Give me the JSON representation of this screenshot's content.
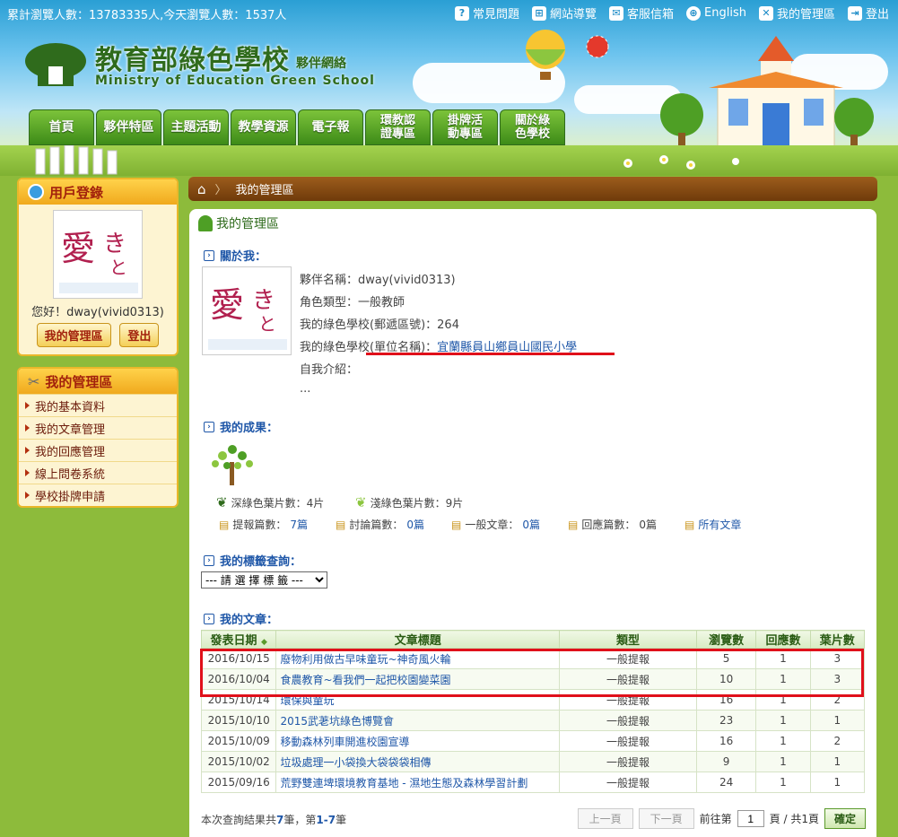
{
  "topbar": {
    "counter": "累計瀏覽人數：13783335人,今天瀏覽人數：1537人",
    "links": [
      "常見問題",
      "網站導覽",
      "客服信箱",
      "English",
      "我的管理區",
      "登出"
    ]
  },
  "logo": {
    "title": "教育部綠色學校",
    "subtitle": "夥伴網絡",
    "english": "Ministry of Education Green School"
  },
  "nav": [
    "首頁",
    "夥伴特區",
    "主題活動",
    "教學資源",
    "電子報",
    "環教認證專區",
    "掛牌活動專區",
    "關於綠色學校"
  ],
  "login": {
    "title": "用戶登錄",
    "greeting": "您好！dway(vivid0313)",
    "my_area": "我的管理區",
    "logout": "登出"
  },
  "manage": {
    "title": "我的管理區",
    "items": [
      "我的基本資料",
      "我的文章管理",
      "我的回應管理",
      "線上問卷系統",
      "學校掛牌申請"
    ]
  },
  "breadcrumb": "我的管理區",
  "main": {
    "title": "我的管理區",
    "about": {
      "heading": "關於我：",
      "partner": "夥伴名稱：dway(vivid0313)",
      "role": "角色類型：一般教師",
      "school_zip_label": "我的綠色學校(郵遞區號)：",
      "school_zip": "264",
      "school_name_label": "我的綠色學校(單位名稱)：",
      "school_name": "宜蘭縣員山鄉員山國民小學",
      "intro_label": "自我介紹：",
      "intro": "..."
    },
    "results": {
      "heading": "我的成果：",
      "dark_leaves": "深綠色葉片數：4片",
      "light_leaves": "淺綠色葉片數：9片",
      "proposal_label": "提報篇數：",
      "proposal": "7篇",
      "discuss_label": "討論篇數：",
      "discuss": "0篇",
      "general_label": "一般文章：",
      "general": "0篇",
      "reply_label": "回應篇數：",
      "reply": "0篇",
      "all": "所有文章"
    },
    "tags": {
      "heading": "我的標籤查詢：",
      "placeholder": "--- 請 選 擇 標 籤 ---"
    },
    "articles": {
      "heading": "我的文章：",
      "columns": [
        "發表日期",
        "文章標題",
        "類型",
        "瀏覽數",
        "回應數",
        "葉片數"
      ],
      "rows": [
        [
          "2016/10/15",
          "廢物利用做古早味童玩~神奇風火輪",
          "一般提報",
          "5",
          "1",
          "3"
        ],
        [
          "2016/10/04",
          "食農教育~看我們一起把校園變菜園",
          "一般提報",
          "10",
          "1",
          "3"
        ],
        [
          "2015/10/14",
          "環保與童玩",
          "一般提報",
          "16",
          "1",
          "2"
        ],
        [
          "2015/10/10",
          "2015武荖坑綠色博覽會",
          "一般提報",
          "23",
          "1",
          "1"
        ],
        [
          "2015/10/09",
          "移動森林列車開進校園宣導",
          "一般提報",
          "16",
          "1",
          "2"
        ],
        [
          "2015/10/02",
          "垃圾處理一小袋換大袋袋袋相傳",
          "一般提報",
          "9",
          "1",
          "1"
        ],
        [
          "2015/09/16",
          "荒野雙連埤環境教育基地 - 濕地生態及森林學習計劃",
          "一般提報",
          "24",
          "1",
          "1"
        ]
      ],
      "result_prefix": "本次查詢結果共",
      "total": "7",
      "result_mid": "筆，第",
      "range": "1-7",
      "result_suffix": "筆",
      "prev": "上一頁",
      "next": "下一頁",
      "goto": "前往第",
      "page": "1",
      "of": "頁 / 共1頁",
      "ok": "確定"
    }
  }
}
